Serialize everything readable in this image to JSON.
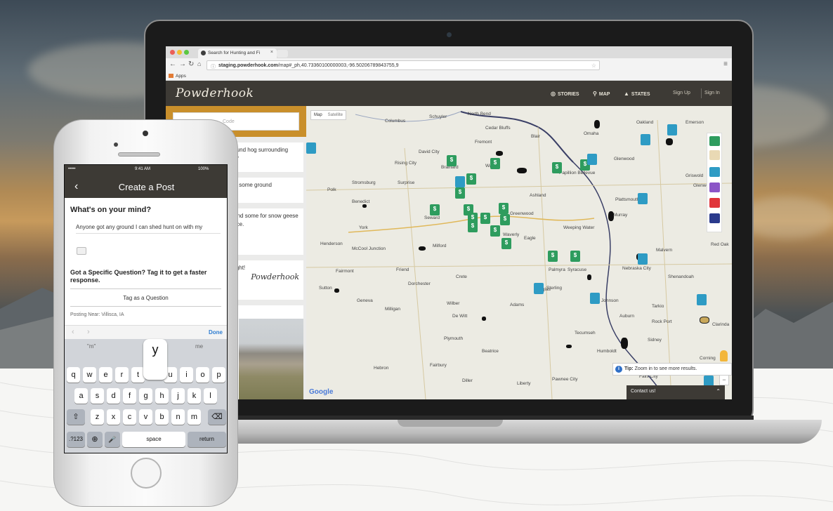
{
  "browser": {
    "tab_title": "Search for Hunting and Fi",
    "tab_close": "×",
    "url_domain": "staging.powderhook.com",
    "url_path": "/map#_ph,40.73360100000003,-96.50206789843755,9",
    "bookmarks_label": "Apps"
  },
  "site": {
    "logo": "Powderhook",
    "nav": {
      "stories": "STORIES",
      "map": "MAP",
      "states": "STATES"
    },
    "sign_up": "Sign Up",
    "sign_in": "Sign In"
  },
  "feed": {
    "search_placeholder": "Code",
    "cards": [
      {
        "text": "od ground hog surrounding states?"
      },
      {
        "text": "ase on some ground"
      },
      {
        "text": "can I find some for snow geese near nce."
      },
      {
        "text": "In tonight!"
      }
    ],
    "signature": "Powderhook"
  },
  "map": {
    "type_map": "Map",
    "type_satellite": "Satellite",
    "cities": [
      "Columbus",
      "Schuyler",
      "North Bend",
      "Oakland",
      "Blair",
      "Cedar Bluffs",
      "Fremont",
      "Omaha",
      "David City",
      "Rising City",
      "Brainard",
      "Wahoo",
      "Ashland",
      "Papillion Bellevue",
      "Glenwood",
      "Stromsburg",
      "Surprise",
      "Polk",
      "Benedict",
      "York",
      "Seward",
      "Waverly",
      "Greenwood",
      "Plattsmouth",
      "Murray",
      "Weeping Water",
      "Eagle",
      "Henderson",
      "McCool Junction",
      "Fairmont",
      "Milford",
      "Crete",
      "Wilber",
      "Dorchester",
      "Friend",
      "De Witt",
      "Adams",
      "Sterling",
      "Johnson",
      "Auburn",
      "Nebraska City",
      "Syracuse",
      "Palmyra",
      "Douglas",
      "Tecumseh",
      "Beatrice",
      "Hebron",
      "Fairbury",
      "Diller",
      "Plymouth",
      "Geneva",
      "Milligan",
      "Sutton",
      "Pawnee City",
      "Liberty",
      "Falls City",
      "Humboldt",
      "Tarkio",
      "Rock Port",
      "Shenandoah",
      "Clarinda",
      "Red Oak",
      "Sidney",
      "Malvern",
      "Glenwood",
      "Griswold",
      "Corning",
      "Emerson"
    ],
    "tip_icon": "i",
    "tip_bold": "Tip:",
    "tip_text": "Zoom in to see more results.",
    "contact": "Contact us!",
    "contact_chevron": "⌃",
    "google": "Google",
    "zoom_plus": "+",
    "zoom_minus": "−"
  },
  "phone": {
    "carrier": "•••••",
    "time": "9:41 AM",
    "battery": "100%",
    "title": "Create a Post",
    "back": "‹",
    "prompt": "What's on your mind?",
    "post_text": "Anyone got any ground I can shed hunt on with my",
    "specific_q": "Got a Specific Question? Tag it to get a faster response.",
    "tag_button": "Tag as a Question",
    "posting_near": "Posting Near: Villisca, IA",
    "done": "Done",
    "suggestions": [
      "\"m\"",
      "me"
    ],
    "pop_key": "y",
    "row1": [
      "q",
      "w",
      "e",
      "r",
      "t",
      "",
      "u",
      "i",
      "o",
      "p"
    ],
    "row2": [
      "a",
      "s",
      "d",
      "f",
      "g",
      "h",
      "j",
      "k",
      "l"
    ],
    "row3": [
      "z",
      "x",
      "c",
      "v",
      "b",
      "n",
      "m"
    ],
    "shift": "⇧",
    "delete": "⌫",
    "num": ".?123",
    "globe": "⊕",
    "mic": "🎤",
    "space": "space",
    "return": "return"
  },
  "colors": {
    "header_bg": "#3d3a35",
    "accent_orange": "#c98f2b",
    "marker_green": "#2e9c5e",
    "marker_teal": "#2e9bc4"
  }
}
